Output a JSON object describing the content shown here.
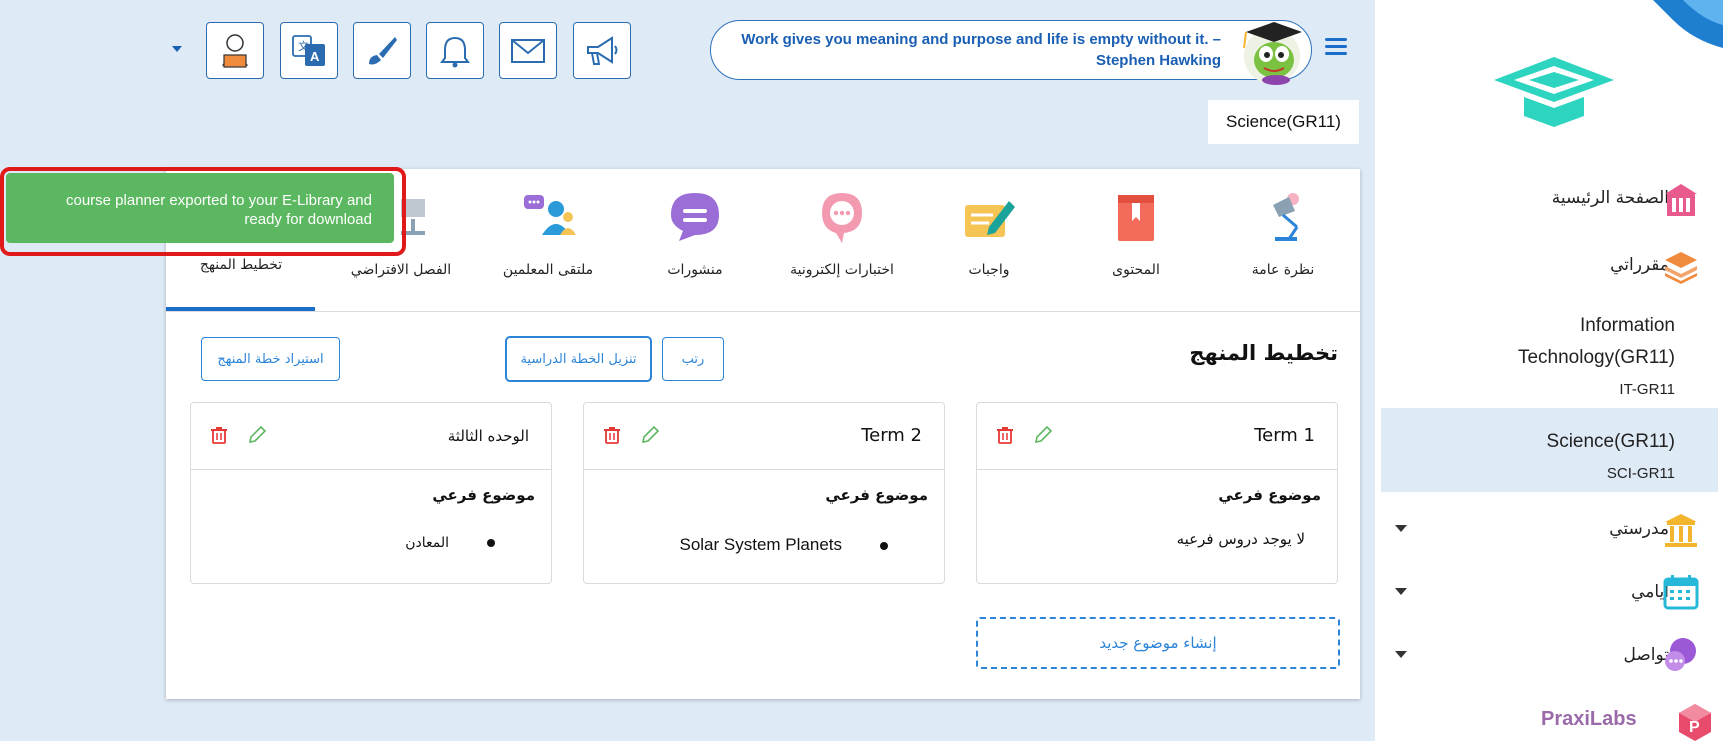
{
  "sidebar": {
    "nav": [
      {
        "label": "الصفحة الرئيسية",
        "icon": "school-building-icon"
      },
      {
        "label": "مقرراتي",
        "icon": "books-stack-icon"
      }
    ],
    "courses": [
      {
        "name": "Information Technology(GR11)",
        "code": "IT-GR11"
      },
      {
        "name": "Science(GR11)",
        "code": "SCI-GR11"
      }
    ],
    "sections": [
      {
        "label": "مدرستي",
        "icon": "institution-icon"
      },
      {
        "label": "أيامي",
        "icon": "calendar-icon"
      },
      {
        "label": "تواصل",
        "icon": "chat-bubbles-icon"
      }
    ],
    "brand": "PraxiLabs",
    "colors": {
      "accent": "#2dd4bf",
      "pink": "#e85a8d",
      "orange": "#f08a3c",
      "gold": "#f3b52e",
      "cyan": "#26b8d9",
      "purple": "#9b59d6"
    }
  },
  "header": {
    "quote": "Work gives you meaning and purpose and life is empty without it. – Stephen Hawking",
    "toolbar_icons": [
      "announcement-icon",
      "mail-icon",
      "bell-icon",
      "brush-icon",
      "translate-icon",
      "reading-user-icon"
    ],
    "course_title": "Science(GR11)"
  },
  "tabs": [
    {
      "label": "نظرة عامة",
      "icon": "desk-lamp-icon"
    },
    {
      "label": "المحتوى",
      "icon": "book-icon"
    },
    {
      "label": "واجبات",
      "icon": "pen-paper-icon"
    },
    {
      "label": "اختبارات إلكترونية",
      "icon": "brain-bubble-icon"
    },
    {
      "label": "منشورات",
      "icon": "speech-bubble-icon"
    },
    {
      "label": "ملتقى المعلمين",
      "icon": "teachers-group-icon"
    },
    {
      "label": "الفصل الافتراضي",
      "icon": "virtual-class-icon"
    },
    {
      "label": "تخطيط المنهج",
      "icon": "curriculum-icon"
    }
  ],
  "planner": {
    "title": "تخطيط المنهج",
    "buttons": {
      "sort": "رتب",
      "download": "تنزيل الخطة الدراسية",
      "import": "استيراد خطة المنهج"
    },
    "terms": [
      {
        "name": "Term 1",
        "subheading": "موضوع فرعي",
        "empty": "لا يوجد دروس فرعيه",
        "items": []
      },
      {
        "name": "Term 2",
        "subheading": "موضوع فرعي",
        "items": [
          "Solar System Planets"
        ]
      },
      {
        "name": "الوحده الثالثة",
        "subheading": "موضوع فرعي",
        "items": [
          "المعادن"
        ]
      }
    ],
    "new_topic": "إنشاء موضوع جديد"
  },
  "toast": {
    "message": "course planner exported to your E-Library and ready for download",
    "color": "#5cb860"
  }
}
